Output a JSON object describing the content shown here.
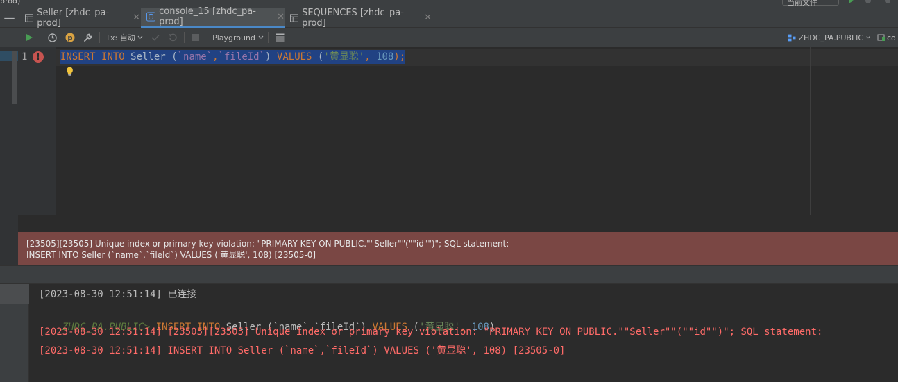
{
  "window": {
    "title_fragment": "prod)",
    "top_combo_label": "当前文件"
  },
  "tabs": [
    {
      "label": "Seller [zhdc_pa-prod]",
      "icon": "table-icon",
      "active": false
    },
    {
      "label": "console_15 [zhdc_pa-prod]",
      "icon": "console-icon",
      "active": true
    },
    {
      "label": "SEQUENCES [zhdc_pa-prod]",
      "icon": "table-icon",
      "active": false
    }
  ],
  "toolbar": {
    "tx_label": "Tx: 自动",
    "mode_label": "Playground",
    "schema_label": "ZHDC_PA.PUBLIC",
    "console_label": "co"
  },
  "editor": {
    "line_number": "1",
    "code_tokens": [
      {
        "text": "INSERT",
        "cls": "kw"
      },
      {
        "text": " ",
        "cls": "plain"
      },
      {
        "text": "INTO",
        "cls": "kw"
      },
      {
        "text": " Seller (",
        "cls": "plain"
      },
      {
        "text": "`name`",
        "cls": "col"
      },
      {
        "text": ",",
        "cls": "kw"
      },
      {
        "text": "`fileId`",
        "cls": "col"
      },
      {
        "text": ") ",
        "cls": "plain"
      },
      {
        "text": "VALUES",
        "cls": "kw"
      },
      {
        "text": " (",
        "cls": "plain"
      },
      {
        "text": "'黄显聪'",
        "cls": "str"
      },
      {
        "text": ", ",
        "cls": "kw"
      },
      {
        "text": "108",
        "cls": "num"
      },
      {
        "text": ");",
        "cls": "kw"
      }
    ]
  },
  "error_banner": {
    "line1": "[23505][23505] Unique index or primary key violation: \"PRIMARY KEY ON PUBLIC.\"\"Seller\"\"(\"\"id\"\")\"; SQL statement:",
    "line2": "INSERT INTO Seller (`name`,`fileId`) VALUES ('黄显聪', 108) [23505-0]"
  },
  "console": {
    "connected": "[2023-08-30 12:51:14] 已连接",
    "prompt": "ZHDC_PA.PUBLIC>",
    "stmt_tokens": [
      {
        "text": " ",
        "cls": "plain"
      },
      {
        "text": "INSERT",
        "cls": "kw"
      },
      {
        "text": " ",
        "cls": "plain"
      },
      {
        "text": "INTO",
        "cls": "kw"
      },
      {
        "text": " Seller (",
        "cls": "c-info"
      },
      {
        "text": "`name`",
        "cls": "c-info"
      },
      {
        "text": ",",
        "cls": "kw"
      },
      {
        "text": "`fileId`",
        "cls": "c-info"
      },
      {
        "text": ") ",
        "cls": "c-info"
      },
      {
        "text": "VALUES",
        "cls": "kw"
      },
      {
        "text": " (",
        "cls": "c-info"
      },
      {
        "text": "'黄显聪'",
        "cls": "str"
      },
      {
        "text": ", ",
        "cls": "kw"
      },
      {
        "text": "108",
        "cls": "num"
      },
      {
        "text": ")",
        "cls": "c-info"
      }
    ],
    "error_line1": "[2023-08-30 12:51:14] [23505][23505] Unique index or primary key violation: \"PRIMARY KEY ON PUBLIC.\"\"Seller\"\"(\"\"id\"\")\"; SQL statement:",
    "error_line2": "[2023-08-30 12:51:14] INSERT INTO Seller (`name`,`fileId`) VALUES ('黄显聪', 108) [23505-0]"
  },
  "colors": {
    "keyword": "#cc7832",
    "string": "#6a8759",
    "number": "#6897bb",
    "column": "#9876aa",
    "error_text": "#ff6b68",
    "error_banner_bg": "#7a4744",
    "selection": "#214283",
    "active_tab_underline": "#4a88c7"
  }
}
